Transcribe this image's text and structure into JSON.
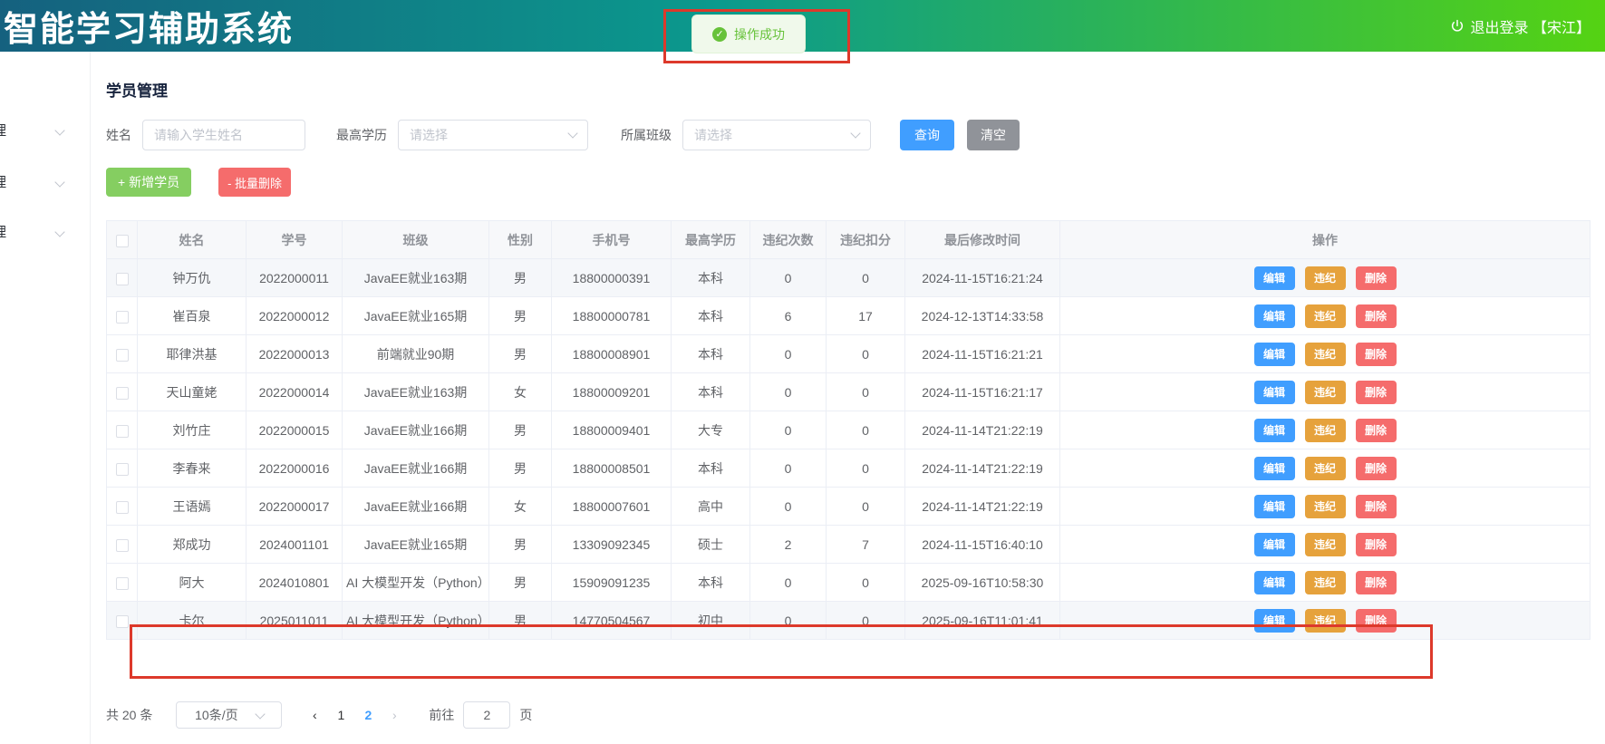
{
  "header": {
    "title": "智能学习辅助系统",
    "logout_label": "退出登录 【宋江】"
  },
  "toast": {
    "text": "操作成功"
  },
  "sidebar": {
    "items": [
      {
        "label": "理"
      },
      {
        "label": "理"
      },
      {
        "label": "理"
      }
    ]
  },
  "page": {
    "title": "学员管理"
  },
  "filters": {
    "name": {
      "label": "姓名",
      "placeholder": "请输入学生姓名"
    },
    "education": {
      "label": "最高学历",
      "placeholder": "请选择"
    },
    "clazz": {
      "label": "所属班级",
      "placeholder": "请选择"
    },
    "search_label": "查询",
    "clear_label": "清空"
  },
  "actions": {
    "add_label": "+ 新增学员",
    "batch_delete_label": "- 批量删除"
  },
  "table": {
    "headers": [
      "姓名",
      "学号",
      "班级",
      "性别",
      "手机号",
      "最高学历",
      "违纪次数",
      "违纪扣分",
      "最后修改时间",
      "操作"
    ],
    "row_actions": [
      "编辑",
      "违纪",
      "删除"
    ],
    "rows": [
      {
        "name": "钟万仇",
        "sid": "2022000011",
        "clazz": "JavaEE就业163期",
        "gender": "男",
        "phone": "18800000391",
        "edu": "本科",
        "violations": "0",
        "deduction": "0",
        "modified": "2024-11-15T16:21:24",
        "highlighted": true
      },
      {
        "name": "崔百泉",
        "sid": "2022000012",
        "clazz": "JavaEE就业165期",
        "gender": "男",
        "phone": "18800000781",
        "edu": "本科",
        "violations": "6",
        "deduction": "17",
        "modified": "2024-12-13T14:33:58",
        "highlighted": false
      },
      {
        "name": "耶律洪基",
        "sid": "2022000013",
        "clazz": "前端就业90期",
        "gender": "男",
        "phone": "18800008901",
        "edu": "本科",
        "violations": "0",
        "deduction": "0",
        "modified": "2024-11-15T16:21:21",
        "highlighted": false
      },
      {
        "name": "天山童姥",
        "sid": "2022000014",
        "clazz": "JavaEE就业163期",
        "gender": "女",
        "phone": "18800009201",
        "edu": "本科",
        "violations": "0",
        "deduction": "0",
        "modified": "2024-11-15T16:21:17",
        "highlighted": false
      },
      {
        "name": "刘竹庄",
        "sid": "2022000015",
        "clazz": "JavaEE就业166期",
        "gender": "男",
        "phone": "18800009401",
        "edu": "大专",
        "violations": "0",
        "deduction": "0",
        "modified": "2024-11-14T21:22:19",
        "highlighted": false
      },
      {
        "name": "李春来",
        "sid": "2022000016",
        "clazz": "JavaEE就业166期",
        "gender": "男",
        "phone": "18800008501",
        "edu": "本科",
        "violations": "0",
        "deduction": "0",
        "modified": "2024-11-14T21:22:19",
        "highlighted": false
      },
      {
        "name": "王语嫣",
        "sid": "2022000017",
        "clazz": "JavaEE就业166期",
        "gender": "女",
        "phone": "18800007601",
        "edu": "高中",
        "violations": "0",
        "deduction": "0",
        "modified": "2024-11-14T21:22:19",
        "highlighted": false
      },
      {
        "name": "郑成功",
        "sid": "2024001101",
        "clazz": "JavaEE就业165期",
        "gender": "男",
        "phone": "13309092345",
        "edu": "硕士",
        "violations": "2",
        "deduction": "7",
        "modified": "2024-11-15T16:40:10",
        "highlighted": false
      },
      {
        "name": "阿大",
        "sid": "2024010801",
        "clazz": "AI 大模型开发（Python）",
        "gender": "男",
        "phone": "15909091235",
        "edu": "本科",
        "violations": "0",
        "deduction": "0",
        "modified": "2025-09-16T10:58:30",
        "highlighted": false
      },
      {
        "name": "卡尔",
        "sid": "2025011011",
        "clazz": "AI 大模型开发（Python）",
        "gender": "男",
        "phone": "14770504567",
        "edu": "初中",
        "violations": "0",
        "deduction": "0",
        "modified": "2025-09-16T11:01:41",
        "highlighted": true
      }
    ]
  },
  "pagination": {
    "total": "共 20 条",
    "page_size": "10条/页",
    "prev": "‹",
    "next": "›",
    "pages": [
      "1",
      "2"
    ],
    "active_page": "2",
    "goto_label": "前往",
    "goto_value": "2",
    "page_unit": "页"
  },
  "colors": {
    "primary": "#409eff",
    "success": "#67c23a",
    "add_button": "#85ce61",
    "warning": "#e6a23c",
    "danger": "#f56c6c",
    "info": "#909399",
    "toast_bg": "#f0f9eb",
    "annotation": "#dd392b",
    "header_gradient_left": "#15617f",
    "header_gradient_mid": "#0b9a8d",
    "header_gradient_right": "#55d313"
  }
}
